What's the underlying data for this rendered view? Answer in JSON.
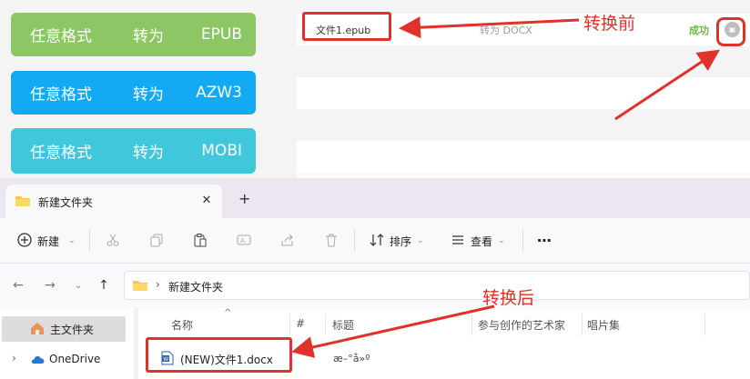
{
  "converter": {
    "buttons": [
      {
        "part1": "任意格式",
        "part2": "转为",
        "part3": "EPUB",
        "color": "#8dc665"
      },
      {
        "part1": "任意格式",
        "part2": "转为",
        "part3": "AZW3",
        "color": "#14aaf3"
      },
      {
        "part1": "任意格式",
        "part2": "转为",
        "part3": "MOBI",
        "color": "#40c7db"
      }
    ],
    "file_row": {
      "name": "文件1.epub",
      "convert_type": "转为 DOCX",
      "status": "成功",
      "status_color": "#62bf3d",
      "action_icon": "folder-open-icon"
    }
  },
  "explorer": {
    "tab": {
      "label": "新建文件夹",
      "close_icon": "close-icon",
      "new_tab_icon": "plus-icon"
    },
    "toolbar": {
      "new_label": "新建",
      "sort_label": "排序",
      "view_label": "查看",
      "icons": [
        "plus-circle-icon",
        "cut-icon",
        "copy-icon",
        "paste-icon",
        "rename-icon",
        "share-icon",
        "delete-icon",
        "sort-icon",
        "view-icon",
        "more-icon"
      ]
    },
    "address": {
      "path": "新建文件夹"
    },
    "nav": {
      "home": "主文件夹",
      "onedrive": "OneDrive"
    },
    "columns": [
      "名称",
      "#",
      "标题",
      "参与创作的艺术家",
      "唱片集"
    ],
    "files": [
      {
        "name": "(NEW)文件1.docx",
        "title": "æ–°å»º"
      }
    ]
  },
  "annotations": {
    "before": "转换前",
    "after": "转换后",
    "color": "#e0312b"
  }
}
